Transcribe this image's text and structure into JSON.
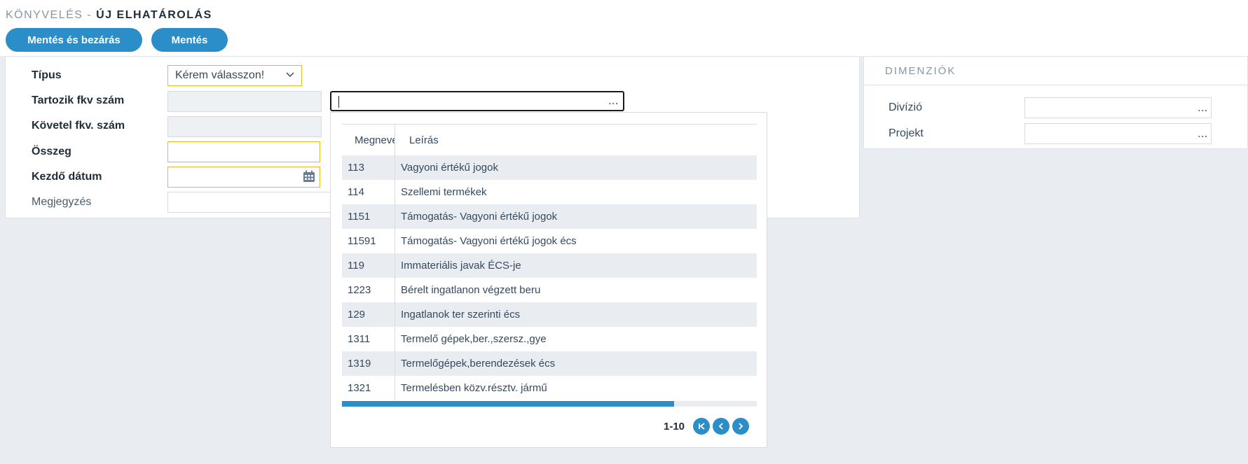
{
  "header": {
    "breadcrumb": "KÖNYVELÉS -",
    "page_title": "ÚJ ELHATÁROLÁS"
  },
  "toolbar": {
    "save_close_label": "Mentés és bezárás",
    "save_label": "Mentés"
  },
  "form": {
    "type_label": "Típus",
    "type_value": "Kérem válasszon!",
    "debit_label": "Tartozik fkv szám",
    "credit_label": "Követel fkv. szám",
    "amount_label": "Összeg",
    "start_date_label": "Kezdő dátum",
    "note_label": "Megjegyzés",
    "more_dots": "..."
  },
  "dropdown": {
    "col_name": "Megnevezés",
    "col_desc": "Leírás",
    "rows": [
      {
        "code": "113",
        "desc": "Vagyoni értékű jogok"
      },
      {
        "code": "114",
        "desc": "Szellemi termékek"
      },
      {
        "code": "1151",
        "desc": "Támogatás- Vagyoni értékű jogok"
      },
      {
        "code": "11591",
        "desc": "Támogatás- Vagyoni értékű jogok écs"
      },
      {
        "code": "119",
        "desc": "Immateriális javak ÉCS-je"
      },
      {
        "code": "1223",
        "desc": "Bérelt ingatlanon végzett beru"
      },
      {
        "code": "129",
        "desc": "Ingatlanok ter szerinti écs"
      },
      {
        "code": "1311",
        "desc": "Termelő gépek,ber.,szersz.,gye"
      },
      {
        "code": "1319",
        "desc": "Termelőgépek,berendezések écs"
      },
      {
        "code": "1321",
        "desc": "Termelésben közv.résztv. jármű"
      }
    ],
    "scroll_fraction": 0.8,
    "pager_text": "1-10"
  },
  "dimensions": {
    "title": "DIMENZIÓK",
    "division_label": "Divízió",
    "project_label": "Projekt"
  },
  "colors": {
    "accent": "#2b8ec8",
    "required_border": "#f0b429",
    "background": "#e9edf1"
  }
}
